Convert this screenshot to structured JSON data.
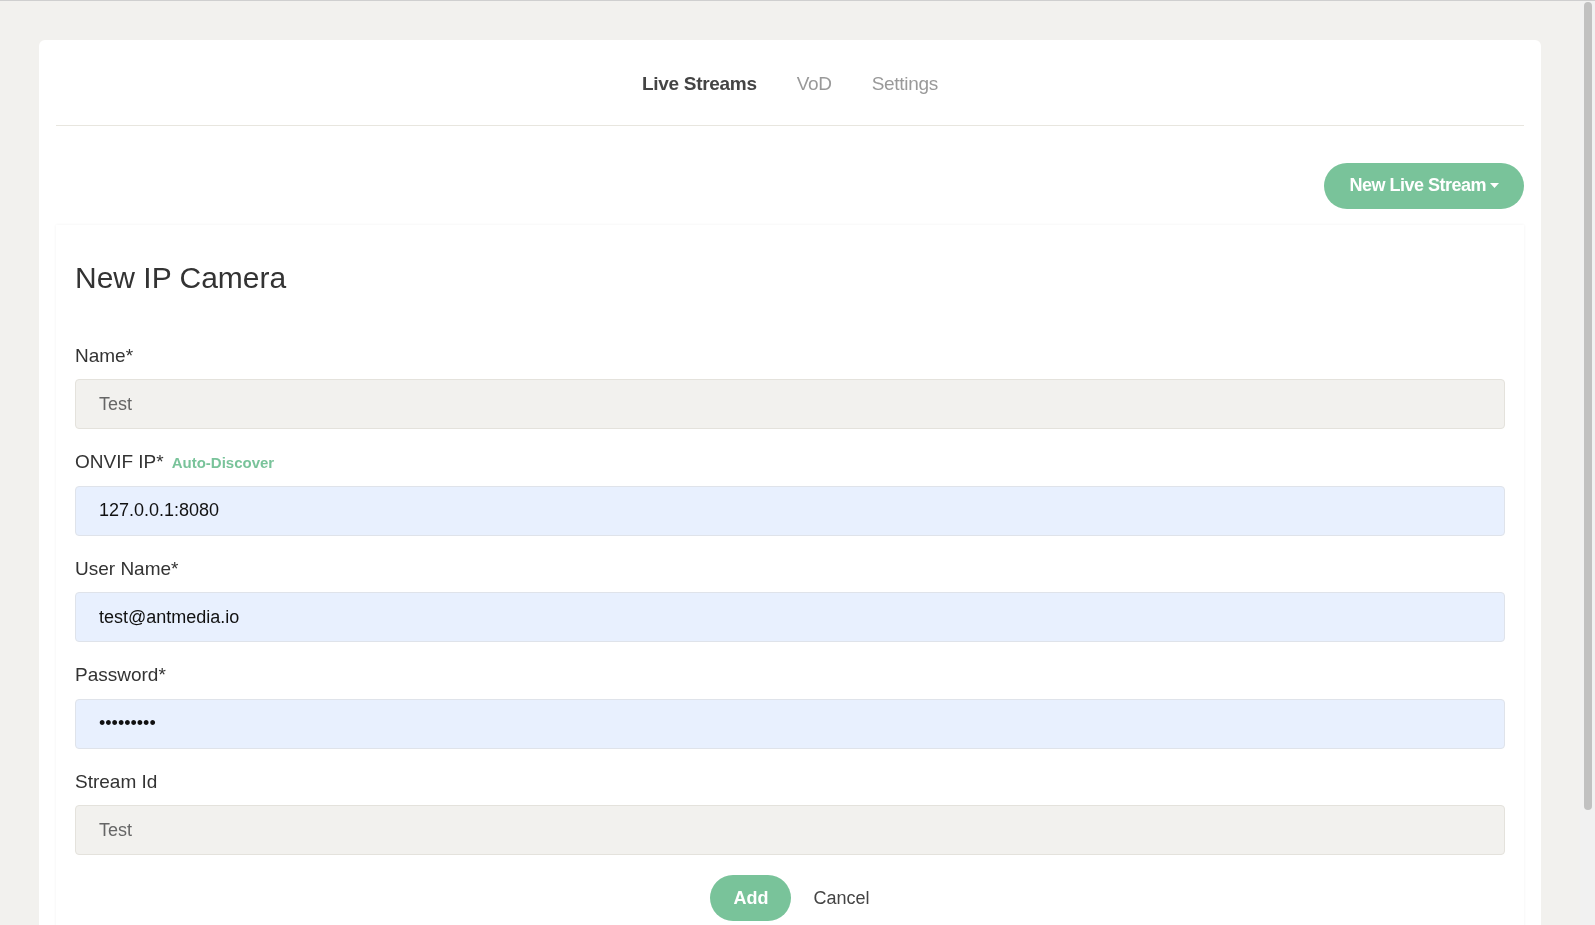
{
  "tabs": [
    {
      "label": "Live Streams",
      "selected": true
    },
    {
      "label": "VoD",
      "selected": false
    },
    {
      "label": "Settings",
      "selected": false
    }
  ],
  "new_button": {
    "label": "New Live Stream"
  },
  "form": {
    "title": "New IP Camera",
    "fields": [
      {
        "label": "Name*",
        "value": "Test",
        "disabled": true
      },
      {
        "label": "ONVIF IP*",
        "link": "Auto-Discover",
        "value": "127.0.0.1:8080",
        "disabled": false
      },
      {
        "label": "User Name*",
        "value": "test@antmedia.io",
        "disabled": false
      },
      {
        "label": "Password*",
        "value": "•••••••••",
        "disabled": false
      },
      {
        "label": "Stream Id",
        "value": "Test",
        "disabled": true
      }
    ],
    "buttons": {
      "submit": "Add",
      "cancel": "Cancel"
    }
  }
}
